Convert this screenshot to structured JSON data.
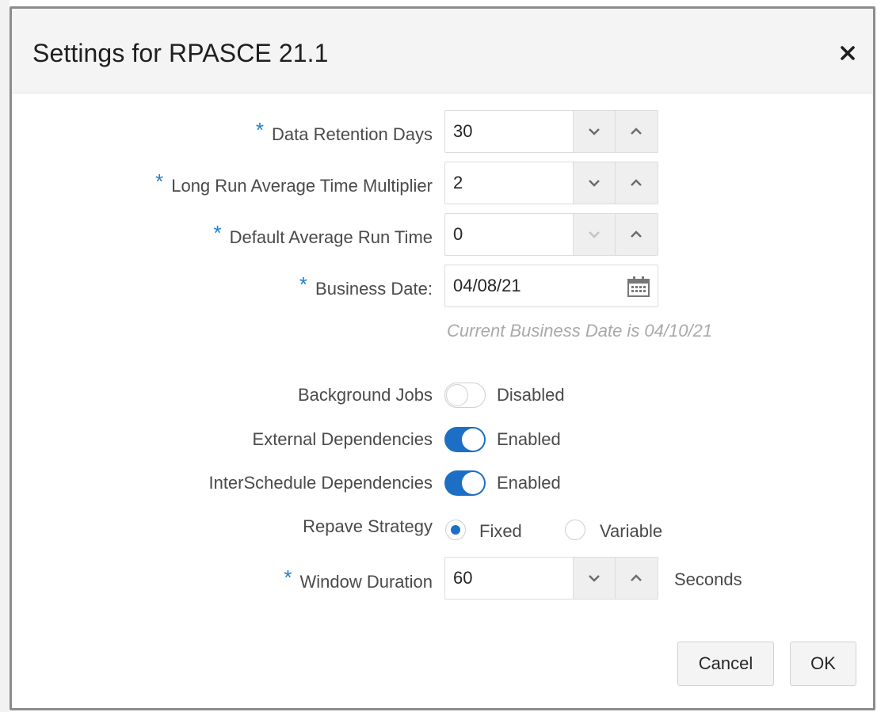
{
  "dialog": {
    "title": "Settings for RPASCE 21.1"
  },
  "fields": {
    "data_retention_days": {
      "label": "Data Retention Days",
      "value": "30"
    },
    "long_run_multiplier": {
      "label": "Long Run Average Time Multiplier",
      "value": "2"
    },
    "default_avg_run_time": {
      "label": "Default Average Run Time",
      "value": "0"
    },
    "business_date": {
      "label": "Business Date:",
      "value": "04/08/21",
      "hint": "Current Business Date is 04/10/21"
    },
    "window_duration": {
      "label": "Window Duration",
      "value": "60",
      "units": "Seconds"
    }
  },
  "required_marker": "*",
  "toggles": {
    "background_jobs": {
      "label": "Background Jobs",
      "state": "Disabled",
      "on": false
    },
    "external_dependencies": {
      "label": "External Dependencies",
      "state": "Enabled",
      "on": true
    },
    "interschedule_dependencies": {
      "label": "InterSchedule Dependencies",
      "state": "Enabled",
      "on": true
    }
  },
  "repave_strategy": {
    "label": "Repave Strategy",
    "options": [
      "Fixed",
      "Variable"
    ],
    "selected": "Fixed"
  },
  "buttons": {
    "cancel": "Cancel",
    "ok": "OK"
  },
  "icons": {
    "close": "close-icon",
    "spin_down": "chevron-down-icon",
    "spin_up": "chevron-up-icon",
    "calendar": "calendar-icon"
  },
  "colors": {
    "accent": "#1c6fc4",
    "required": "#1f7ec9",
    "hint": "#a9a9a9"
  }
}
